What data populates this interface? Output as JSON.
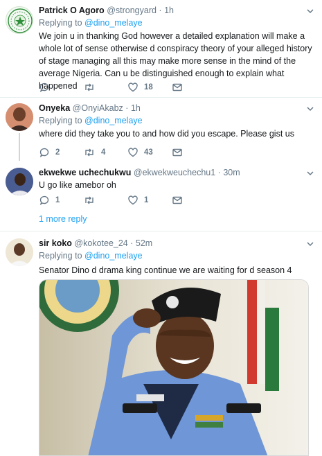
{
  "tweets": [
    {
      "name": "Patrick O Agoro",
      "handle": "@strongyard",
      "time": "1h",
      "replying_prefix": "Replying to",
      "replying_to": "@dino_melaye",
      "text": "We join u in thanking God however a detailed explanation will make a whole lot of sense otherwise d conspiracy theory of your alleged history of stage managing all this may make more sense in the mind of the average Nigeria. Can u be distinguished enough to explain what happened",
      "replies": "",
      "retweets": "",
      "likes": "18"
    },
    {
      "name": "Onyeka",
      "handle": "@OnyiAkabz",
      "time": "1h",
      "replying_prefix": "Replying to",
      "replying_to": "@dino_melaye",
      "text": "where did they take you to and how did you escape. Please gist us",
      "replies": "2",
      "retweets": "4",
      "likes": "43"
    },
    {
      "name": "ekwekwe uchechukwu",
      "handle": "@ekwekweuchechu1",
      "time": "30m",
      "text": "U go like amebor oh",
      "replies": "1",
      "retweets": "",
      "likes": "1"
    },
    {
      "name": "sir koko",
      "handle": "@kokotee_24",
      "time": "52m",
      "replying_prefix": "Replying to",
      "replying_to": "@dino_melaye",
      "text": "Senator Dino d drama king continue we are waiting for d season 4",
      "photo_plaque_text": "D. Idgai"
    }
  ],
  "more_replies": "1 more reply",
  "dot": "·",
  "colors": {
    "accent": "#1da1f2",
    "muted": "#657786",
    "border": "#e6ecf0",
    "like": "#e0245e"
  }
}
